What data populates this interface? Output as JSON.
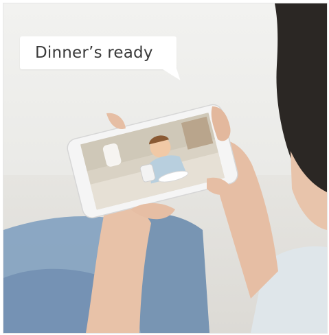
{
  "speech_bubble": {
    "text": "Dinner’s ready"
  },
  "scene": {
    "description_icon": "woman-holding-phone-icon",
    "phone_screen_icon": "child-eating-video-icon"
  },
  "colors": {
    "background": "#ecebe7",
    "jeans": "#7f9dbb",
    "skin": "#e9c3aa",
    "hair": "#2a2623",
    "phone_frame": "#f4f4f4"
  }
}
